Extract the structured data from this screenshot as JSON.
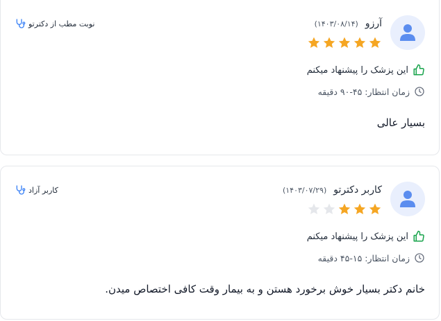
{
  "colors": {
    "star_filled": "#f5a623",
    "star_empty": "#e5e7eb",
    "thumb": "#16a34a",
    "badge_icon": "#3b82f6",
    "avatar_bg": "#e9effd",
    "avatar_fg": "#5b8def"
  },
  "reviews": [
    {
      "name": "آرزو",
      "date": "(۱۴۰۳/۰۸/۱۴)",
      "rating": 5,
      "recommend": "این پزشک را پیشنهاد میکنم",
      "wait": "زمان انتظار: ۴۵-۹۰ دقیقه",
      "comment": "بسیار عالی",
      "badge": "نوبت مطب از دکترتو",
      "icons": {
        "avatar": "user-icon",
        "recommend": "thumbs-up-icon",
        "wait": "clock-icon",
        "badge": "stethoscope-icon"
      }
    },
    {
      "name": "کاربر دکترتو",
      "date": "(۱۴۰۳/۰۷/۲۹)",
      "rating": 3,
      "recommend": "این پزشک را پیشنهاد میکنم",
      "wait": "زمان انتظار: ۱۵-۴۵ دقیقه",
      "comment": "خانم دکتر بسیار خوش برخورد هستن و به بیمار وقت کافی اختصاص میدن.",
      "badge": "کاربر آزاد",
      "icons": {
        "avatar": "user-icon",
        "recommend": "thumbs-up-icon",
        "wait": "clock-icon",
        "badge": "stethoscope-icon"
      }
    }
  ]
}
